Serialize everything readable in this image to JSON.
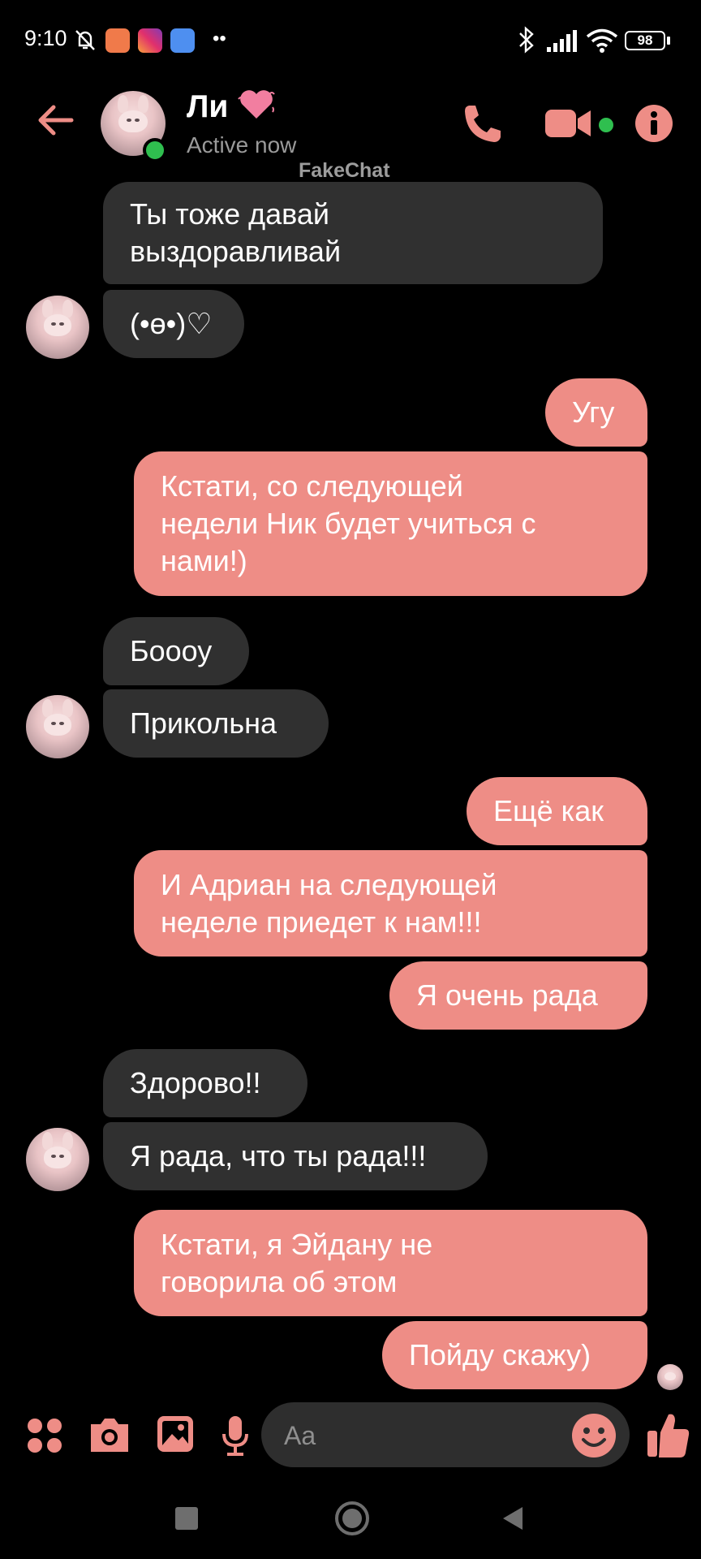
{
  "status_bar": {
    "time": "9:10",
    "battery": "98"
  },
  "header": {
    "name": "Ли",
    "status": "Active now"
  },
  "watermark": "FakeChat",
  "messages": [
    {
      "text": "Ты тоже давай\nвыздоравливай"
    },
    {
      "text": "(•ɵ•)♡"
    },
    {
      "text": "Угу"
    },
    {
      "text": "Кстати, со следующей\nнедели Ник будет учиться с\nнами!)"
    },
    {
      "text": "Боооу"
    },
    {
      "text": "Прикольна"
    },
    {
      "text": "Ещё как"
    },
    {
      "text": "И Адриан на следующей\nнеделе приедет к нам!!!"
    },
    {
      "text": "Я очень рада"
    },
    {
      "text": "Здорово!!"
    },
    {
      "text": "Я рада, что ты рада!!!"
    },
    {
      "text": "Кстати, я Эйдану не\nговорила об этом"
    },
    {
      "text": "Пойду скажу)"
    }
  ],
  "composer": {
    "placeholder": "Aa"
  },
  "colors": {
    "accent": "#ee8d86",
    "incoming": "#303030",
    "online": "#2fbf4f"
  }
}
